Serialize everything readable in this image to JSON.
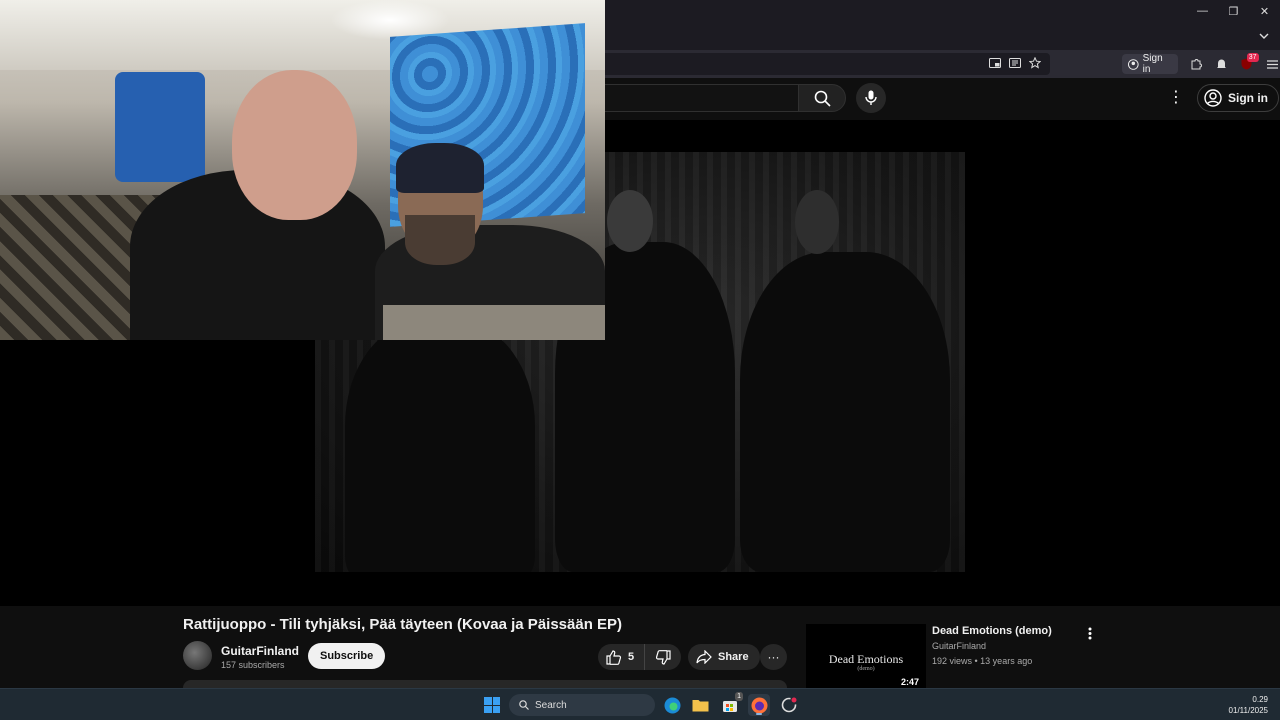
{
  "browser": {
    "window_controls": {
      "minimize": "—",
      "maximize": "❐",
      "close": "✕"
    },
    "tab_list_icon": "chevron-down",
    "account_chip": "Sign in",
    "extension_badges": {
      "notify": "",
      "ublock": "37"
    }
  },
  "youtube": {
    "search": {
      "placeholder": ""
    },
    "signin_label": "Sign in",
    "more_icon": "⋮"
  },
  "video": {
    "title": "Rattijuoppo - Tili tyhjäksi, Pää täyteen (Kovaa ja Päissään EP)",
    "channel": {
      "name": "GuitarFinland",
      "subscribers": "157 subscribers"
    },
    "subscribe_label": "Subscribe",
    "likes": "5",
    "share_label": "Share",
    "more_label": "···"
  },
  "recommended": [
    {
      "thumb_title": "Dead Emotions",
      "thumb_subtitle": "(demo)",
      "duration": "2:47",
      "title": "Dead Emotions (demo)",
      "channel": "GuitarFinland",
      "meta": "192 views • 13 years ago"
    }
  ],
  "taskbar": {
    "search_label": "Search",
    "store_badge": "1",
    "clock": {
      "time": "0.29",
      "date": "01/11/2025"
    }
  },
  "colors": {
    "accent_badge": "#e22850",
    "youtube_bg": "#0f0f0f"
  }
}
